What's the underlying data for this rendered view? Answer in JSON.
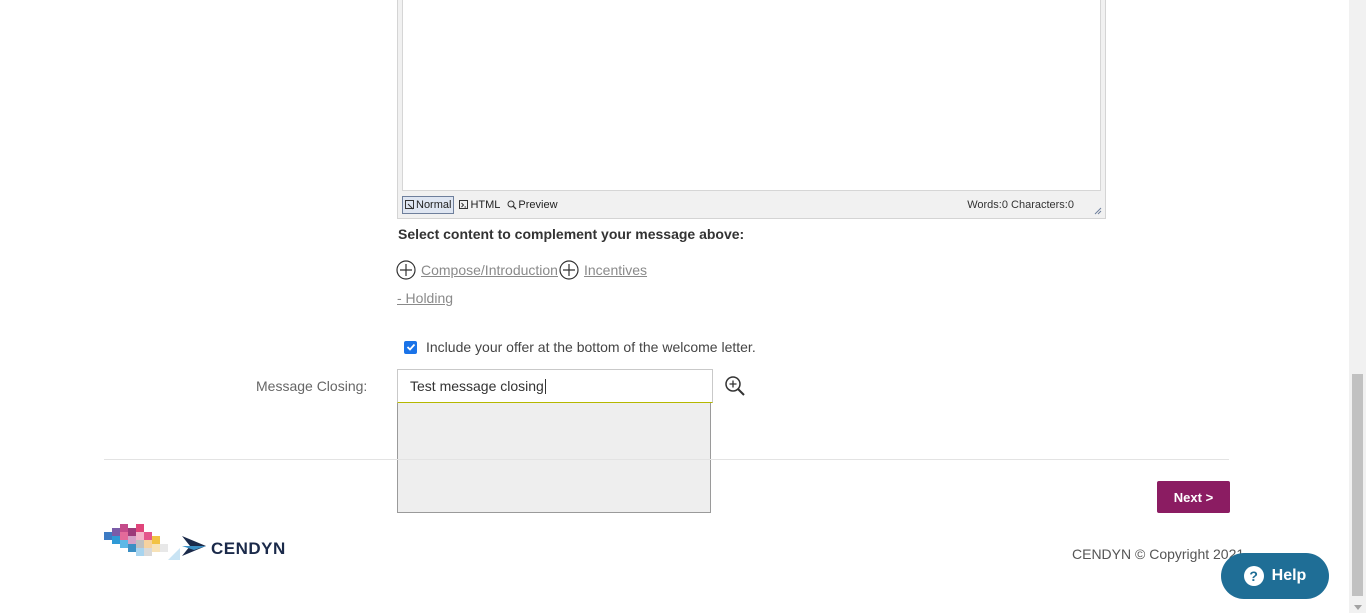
{
  "editor": {
    "modes": [
      {
        "label": "Normal",
        "icon": "normal-mode-icon",
        "active": true
      },
      {
        "label": "HTML",
        "icon": "html-mode-icon",
        "active": false
      },
      {
        "label": "Preview",
        "icon": "preview-icon",
        "active": false
      }
    ],
    "word_count": "Words:0 Characters:0"
  },
  "content_section": {
    "heading": "Select content to complement your message above:",
    "links": [
      {
        "label": "Compose/Introduction"
      },
      {
        "label": "Incentives"
      },
      {
        "label": "- Holding"
      }
    ]
  },
  "offer": {
    "label": "Include your offer at the bottom of the welcome letter.",
    "checked": true
  },
  "message_closing": {
    "label": "Message Closing:",
    "value": "Test message closing"
  },
  "actions": {
    "next_label": "Next  >"
  },
  "footer": {
    "logo_text": "CENDYN",
    "copyright": "CENDYN © Copyright 2021"
  },
  "help": {
    "label": "Help"
  },
  "colors": {
    "next_button": "#8b1c62",
    "help_button": "#1f6e96",
    "checkbox": "#1a73e8"
  }
}
